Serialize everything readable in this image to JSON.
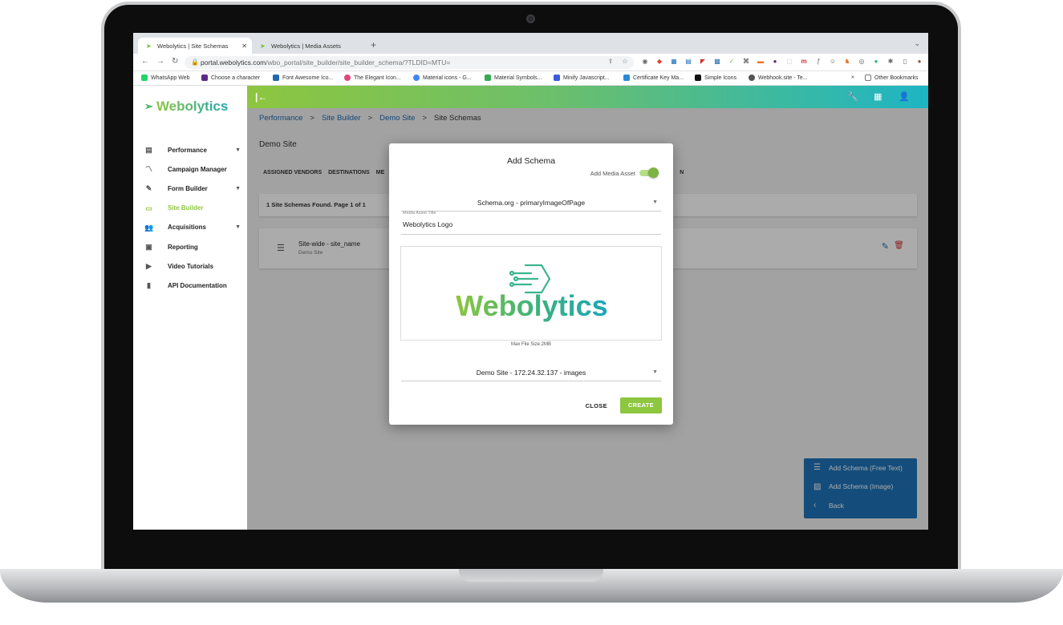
{
  "browser": {
    "tabs": [
      {
        "title": "Webolytics | Site Schemas",
        "active": true
      },
      {
        "title": "Webolytics | Media Assets",
        "active": false
      }
    ],
    "url_domain": "portal.webolytics.com",
    "url_path": "/wbo_portal/site_builder/site_builder_schema/?TLDID=MTU=",
    "bookmarks": [
      {
        "label": "WhatsApp Web",
        "color": "#25d366"
      },
      {
        "label": "Choose a character",
        "color": "#5b2a86"
      },
      {
        "label": "Font Awesome Ico...",
        "color": "#1d6ab0"
      },
      {
        "label": "The Elegant Icon...",
        "color": "#e0457b"
      },
      {
        "label": "Material icons - G...",
        "color": "#4285f4"
      },
      {
        "label": "Material Symbols...",
        "color": "#34a853"
      },
      {
        "label": "Minify Javascript...",
        "color": "#3b5bdb"
      },
      {
        "label": "Certificate Key Ma...",
        "color": "#2b8ad8"
      },
      {
        "label": "Simple Icons",
        "color": "#111111"
      },
      {
        "label": "Webhook.site - Te...",
        "color": "#555555"
      }
    ],
    "bookmarks_more": "»",
    "other_bookmarks": "Other Bookmarks"
  },
  "sidebar": {
    "brand": "Webolytics",
    "items": [
      {
        "label": "Performance",
        "icon": "dashboard-icon",
        "glyph": "▤",
        "expandable": true,
        "active": false
      },
      {
        "label": "Campaign Manager",
        "icon": "trending-icon",
        "glyph": "〽",
        "expandable": false,
        "active": false
      },
      {
        "label": "Form Builder",
        "icon": "form-icon",
        "glyph": "✎",
        "expandable": true,
        "active": false
      },
      {
        "label": "Site Builder",
        "icon": "web-icon",
        "glyph": "▭",
        "expandable": false,
        "active": true
      },
      {
        "label": "Acquisitions",
        "icon": "people-icon",
        "glyph": "👥",
        "expandable": true,
        "active": false
      },
      {
        "label": "Reporting",
        "icon": "report-icon",
        "glyph": "▣",
        "expandable": false,
        "active": false
      },
      {
        "label": "Video Tutorials",
        "icon": "video-icon",
        "glyph": "▶",
        "expandable": false,
        "active": false
      },
      {
        "label": "API Documentation",
        "icon": "book-icon",
        "glyph": "▮",
        "expandable": false,
        "active": false
      }
    ]
  },
  "breadcrumb": [
    "Performance",
    "Site Builder",
    "Demo Site",
    "Site Schemas"
  ],
  "page_title": "Demo Site",
  "subtabs": [
    "ASSIGNED VENDORS",
    "DESTINATIONS",
    "ME",
    "N"
  ],
  "found_text": "1 Site Schemas Found. Page 1 of 1",
  "schema_item": {
    "name": "Site-wide - site_name",
    "site": "Demo Site"
  },
  "fab_menu": [
    {
      "label": "Add Schema (Free Text)",
      "icon": "lines-icon",
      "glyph": "☰"
    },
    {
      "label": "Add Schema (Image)",
      "icon": "image-icon",
      "glyph": "▨"
    },
    {
      "label": "Back",
      "icon": "chevron-left-icon",
      "glyph": "‹"
    }
  ],
  "dialog": {
    "title": "Add Schema",
    "toggle_label": "Add Media Asset",
    "toggle_on": true,
    "schema_select": "Schema.org - primaryImageOfPage",
    "field_label": "Media Asset Title",
    "field_value": "Webolytics Logo",
    "preview_text": "Webolytics",
    "max_size": "Max File Size:2MB",
    "site_select": "Demo Site - 172.24.32.137 - images",
    "close_label": "CLOSE",
    "create_label": "CREATE"
  },
  "colors": {
    "brand_green": "#8dc63f",
    "brand_teal": "#1db5c4",
    "link_blue": "#1d6ab0"
  }
}
